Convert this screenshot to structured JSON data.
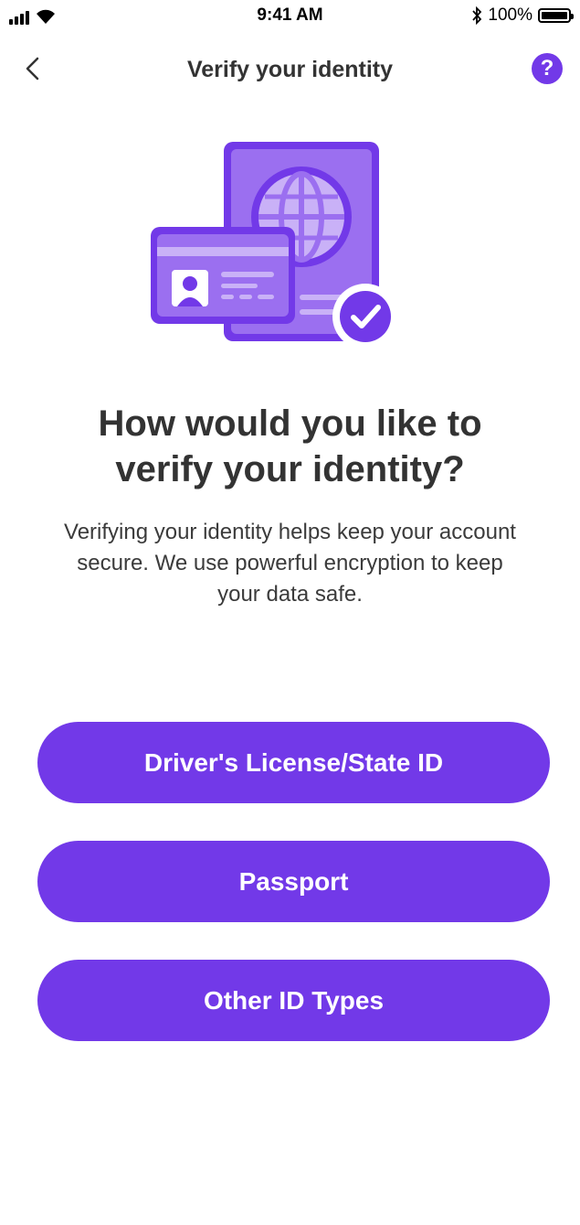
{
  "status_bar": {
    "time": "9:41 AM",
    "battery": "100%",
    "icons": [
      "signal-icon",
      "wifi-icon",
      "bluetooth-icon",
      "battery-icon"
    ]
  },
  "nav": {
    "title": "Verify your identity",
    "back_icon": "chevron-left-icon",
    "help_label": "?"
  },
  "illustration": {
    "icon": "id-card-passport-verified-illustration"
  },
  "content": {
    "headline_line1": "How would you like to",
    "headline_line2": "verify your identity?",
    "description": "Verifying your identity helps keep your account secure. We use powerful encryption to keep your data safe."
  },
  "options": [
    {
      "label": "Driver's License/State ID"
    },
    {
      "label": "Passport"
    },
    {
      "label": "Other ID Types"
    }
  ],
  "colors": {
    "accent": "#7239e8",
    "accent_light": "#9b6ff0",
    "accent_pale": "#c9b1f7",
    "text_dark": "#333333"
  }
}
